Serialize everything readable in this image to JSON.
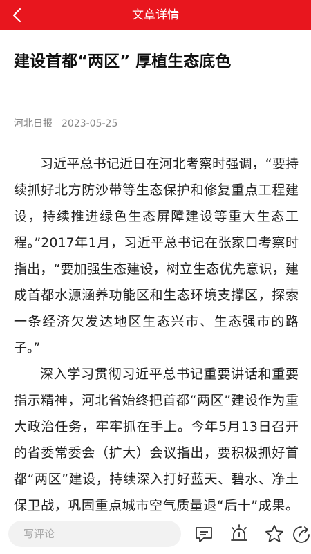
{
  "header": {
    "title": "文章详情",
    "back_icon": "back-arrow-icon"
  },
  "article": {
    "title": "建设首都“两区” 厚植生态底色",
    "source": "河北日报",
    "date": "2023-05-25",
    "paragraphs": [
      "习近平总书记近日在河北考察时强调，“要持续抓好北方防沙带等生态保护和修复重点工程建设，持续推进绿色生态屏障建设等重大生态工程。”2017年1月，习近平总书记在张家口考察时指出，“要加强生态建设，树立生态优先意识，建成首都水源涵养功能区和生态环境支撑区，探索一条经济欠发达地区生态兴市、生态强市的路子。”",
      "深入学习贯彻习近平总书记重要讲话和重要指示精神，河北省始终把首都“两区”建设作为重大政治任务，牢牢抓在手上。今年5月13日召开的省委常委会（扩大）会议指出，要积极抓好首都“两区”建设，持续深入打好蓝天、碧水、净土保卫战，巩固重点城市空气质量退“后十”成果。首都“两区”建设不断向"
    ]
  },
  "bottombar": {
    "comment_placeholder": "写评论",
    "icons": [
      "comment-icon",
      "alert-icon",
      "star-icon",
      "share-icon"
    ]
  },
  "colors": {
    "brand_red": "#e8161e"
  }
}
